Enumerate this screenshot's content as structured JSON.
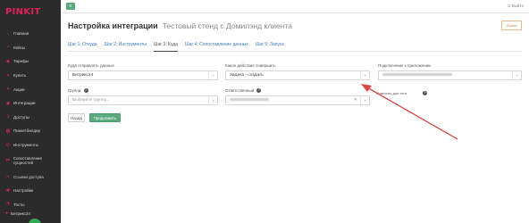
{
  "logo": {
    "text": "PINKIT"
  },
  "sidebar": {
    "items": [
      {
        "label": "Главная",
        "icon": "home-icon"
      },
      {
        "label": "Кейсы",
        "icon": "briefcase-icon"
      },
      {
        "label": "Тарифы",
        "icon": "tag-icon"
      },
      {
        "label": "Купить",
        "icon": "cart-icon"
      },
      {
        "label": "Акции",
        "icon": "gift-icon"
      },
      {
        "label": "Интеграции",
        "icon": "plug-icon"
      },
      {
        "label": "Доступы",
        "icon": "key-icon"
      },
      {
        "label": "Пинкетбилдер",
        "icon": "build-icon"
      },
      {
        "label": "Инструменты",
        "icon": "wrench-icon"
      },
      {
        "label": "Сопоставление сущностей",
        "icon": "link-icon"
      },
      {
        "label": "Ссылки доступа",
        "icon": "chain-icon"
      },
      {
        "label": "Настройки",
        "icon": "gear-icon"
      },
      {
        "label": "Тесты",
        "icon": "flask-icon"
      }
    ],
    "footer_label": "Битрикс24"
  },
  "topbar": {
    "logout_label": "Выйти"
  },
  "header": {
    "title": "Настройка интеграции",
    "subtitle": "Тестовый стенд с Домилэнд клиента",
    "help_label": "Нужна"
  },
  "tabs": [
    {
      "label": "Шаг 1: Откуда",
      "active": false
    },
    {
      "label": "Шаг 2: Инструменты",
      "active": false
    },
    {
      "label": "Шаг 3: Куда",
      "active": true
    },
    {
      "label": "Шаг 4: Сопоставление данных",
      "active": false
    },
    {
      "label": "Шаг 5: Запуск",
      "active": false
    }
  ],
  "form": {
    "destination_label": "Куда отправлять данные",
    "destination_value": "Битрикс24",
    "action_label": "Какое действие совершить",
    "action_value": "Задача - создать",
    "connection_label": "Подключение к приложению",
    "group_label": "Группа",
    "group_placeholder": "Выберите группу...",
    "responsible_label": "Ответственный",
    "checkbox_label": "Повесить доп.теги"
  },
  "buttons": {
    "back_label": "Назад",
    "next_label": "Продолжить"
  },
  "colors": {
    "accent": "#e0215b",
    "primary": "#5aaa7e",
    "sidebar": "#2b2b2b",
    "annotation_arrow": "#d94848"
  }
}
